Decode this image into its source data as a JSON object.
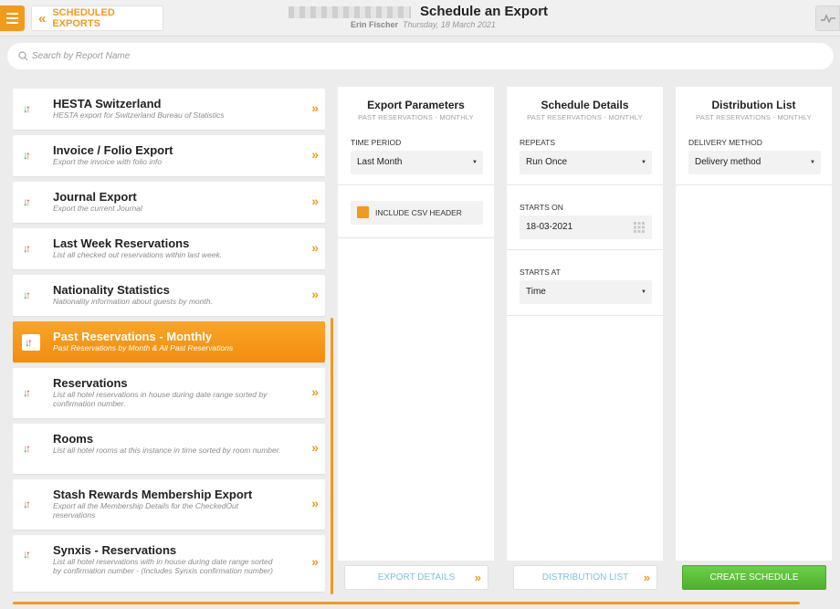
{
  "header": {
    "back_label": "SCHEDULED EXPORTS",
    "title": "Schedule an Export",
    "user": "Erin Fischer",
    "date": "Thursday, 18 March 2021"
  },
  "search": {
    "placeholder": "Search by Report Name"
  },
  "reports": [
    {
      "name": "HESTA Switzerland",
      "desc": "HESTA export for Switzerland Bureau of Statistics"
    },
    {
      "name": "Invoice / Folio Export",
      "desc": "Export the invoice with folio info"
    },
    {
      "name": "Journal Export",
      "desc": "Export the current Journal"
    },
    {
      "name": "Last Week Reservations",
      "desc": "List all checked out reservations within last week."
    },
    {
      "name": "Nationality Statistics",
      "desc": "Nationality information about guests by month."
    },
    {
      "name": "Past Reservations - Monthly",
      "desc": "Past Reservations by Month & All Past Reservations"
    },
    {
      "name": "Reservations",
      "desc": "List all hotel reservations in house during date range sorted by confirmation number."
    },
    {
      "name": "Rooms",
      "desc": "List all hotel rooms at this instance in time sorted by room number."
    },
    {
      "name": "Stash Rewards Membership Export",
      "desc": "Export all the Membership Details for the CheckedOut reservations"
    },
    {
      "name": "Synxis - Reservations",
      "desc": "List all hotel reservations with in house during date range sorted by confirmation number - (Includes Synxis confirmation number)"
    }
  ],
  "export_params": {
    "title": "Export Parameters",
    "subtitle": "PAST RESERVATIONS - MONTHLY",
    "time_period_label": "TIME PERIOD",
    "time_period_value": "Last Month",
    "csv_header_label": "INCLUDE CSV HEADER",
    "footer_label": "EXPORT DETAILS"
  },
  "schedule": {
    "title": "Schedule Details",
    "subtitle": "PAST RESERVATIONS - MONTHLY",
    "repeats_label": "REPEATS",
    "repeats_value": "Run Once",
    "starts_on_label": "STARTS ON",
    "starts_on_value": "18-03-2021",
    "starts_at_label": "STARTS AT",
    "starts_at_value": "Time",
    "footer_label": "DISTRIBUTION LIST"
  },
  "distribution": {
    "title": "Distribution List",
    "subtitle": "PAST RESERVATIONS - MONTHLY",
    "method_label": "DELIVERY METHOD",
    "method_value": "Delivery method",
    "footer_label": "CREATE SCHEDULE"
  },
  "colors": {
    "accent": "#f29a1c",
    "create": "#5cc03b",
    "link": "#7fc1dc"
  },
  "icons": {
    "menu": "hamburger-icon",
    "back": "double-chevron-left-icon",
    "activity": "activity-pulse-icon",
    "search": "search-icon",
    "report_type": "down-up-arrows-icon",
    "go": "double-chevron-right-icon",
    "calendar": "calendar-grid-icon",
    "caret": "caret-down-icon"
  }
}
